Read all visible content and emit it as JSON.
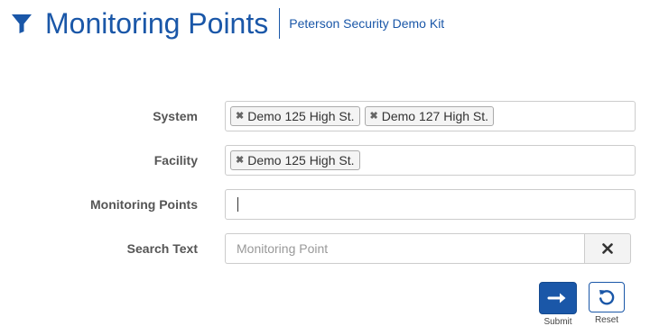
{
  "header": {
    "title": "Monitoring Points",
    "subtitle": "Peterson Security Demo Kit"
  },
  "form": {
    "system": {
      "label": "System",
      "tags": [
        "Demo 125 High St.",
        "Demo 127 High St."
      ]
    },
    "facility": {
      "label": "Facility",
      "tags": [
        "Demo 125 High St."
      ]
    },
    "monitoring_points": {
      "label": "Monitoring Points",
      "value": ""
    },
    "search_text": {
      "label": "Search Text",
      "value": "",
      "placeholder": "Monitoring Point"
    }
  },
  "actions": {
    "submit_label": "Submit",
    "reset_label": "Reset"
  },
  "icons": {
    "filter": "filter-icon",
    "tag_remove": "times-icon",
    "clear": "times-icon",
    "submit": "arrow-right-icon",
    "reset": "rotate-left-icon"
  },
  "colors": {
    "brand": "#1a57a8",
    "label": "#555555",
    "border": "#cccccc"
  }
}
